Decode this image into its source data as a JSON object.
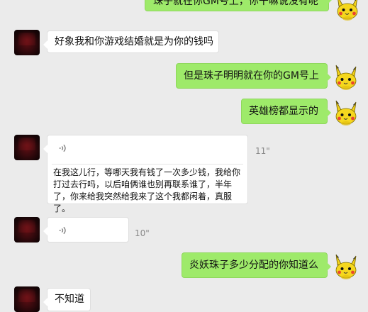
{
  "messages": [
    {
      "side": "right",
      "type": "text",
      "text": "珠子就在你GM号上，你干嘛说没有呢"
    },
    {
      "side": "left",
      "type": "text",
      "text": "好象我和你游戏结婚就是为你的钱吗"
    },
    {
      "side": "right",
      "type": "text",
      "text": "但是珠子明明就在你的GM号上"
    },
    {
      "side": "right",
      "type": "text",
      "text": "英雄榜都显示的"
    },
    {
      "side": "left",
      "type": "voice",
      "duration": "11\"",
      "transcript": "在我这儿行，等哪天我有钱了一次多少钱，我给你打过去行吗，以后咱俩谁也别再联系谁了，半年了，你来给我突然给我来了这个我都闲着，真服了。"
    },
    {
      "side": "left",
      "type": "voice",
      "duration": "10\""
    },
    {
      "side": "right",
      "type": "text",
      "text": "炎妖珠子多少分配的你知道么"
    },
    {
      "side": "left",
      "type": "text",
      "text": "不知道"
    }
  ],
  "icons": {
    "contact_avatar": "avatar",
    "self_avatar": "pikachu-avatar",
    "voice": "voice-wave-icon"
  }
}
